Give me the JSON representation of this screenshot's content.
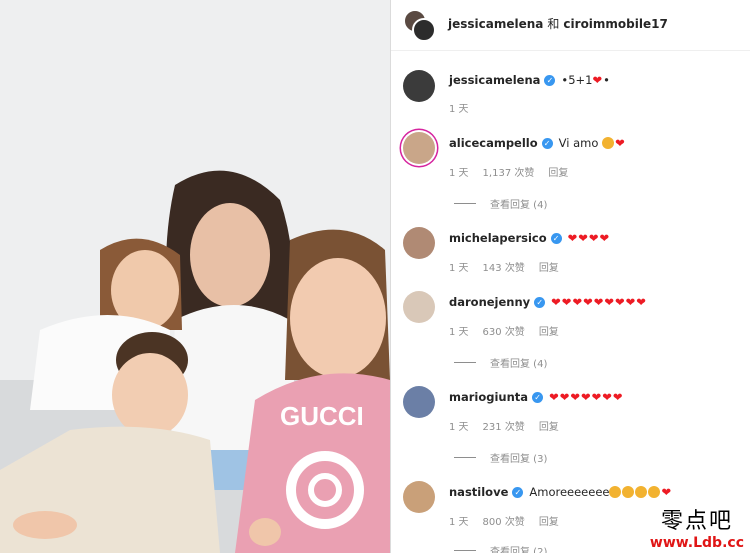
{
  "header": {
    "user1": "jessicamelena",
    "conjunction": "和",
    "user2": "ciroimmobile17"
  },
  "caption": {
    "username": "jessicamelena",
    "text": "•5+1",
    "text_after": "•",
    "time": "1 天"
  },
  "comments": [
    {
      "username": "alicecampello",
      "text": "Vi amo",
      "emoji": "😭❤",
      "time": "1 天",
      "likes": "1,137 次赞",
      "reply": "回复",
      "view_replies": "查看回复 (4)"
    },
    {
      "username": "michelapersico",
      "text": "",
      "emoji": "❤❤❤❤",
      "time": "1 天",
      "likes": "143 次赞",
      "reply": "回复",
      "view_replies": ""
    },
    {
      "username": "daronejenny",
      "text": "",
      "emoji": "❤❤❤❤❤❤❤❤❤",
      "time": "1 天",
      "likes": "630 次赞",
      "reply": "回复",
      "view_replies": "查看回复 (4)"
    },
    {
      "username": "mariogiunta",
      "text": "",
      "emoji": "❤❤❤❤❤❤❤",
      "time": "1 天",
      "likes": "231 次赞",
      "reply": "回复",
      "view_replies": "查看回复 (3)"
    },
    {
      "username": "nastilove",
      "text": "Amoreeeeeee",
      "emoji": "❤",
      "time": "1 天",
      "likes": "800 次赞",
      "reply": "回复",
      "view_replies": "查看回复 (2)"
    }
  ],
  "watermark": {
    "cn": "零点吧",
    "url": "www.Ldb.cc"
  },
  "colors": {
    "verified": "#3897f0",
    "heart": "#ed1b24",
    "muted": "#8e8e8e"
  }
}
